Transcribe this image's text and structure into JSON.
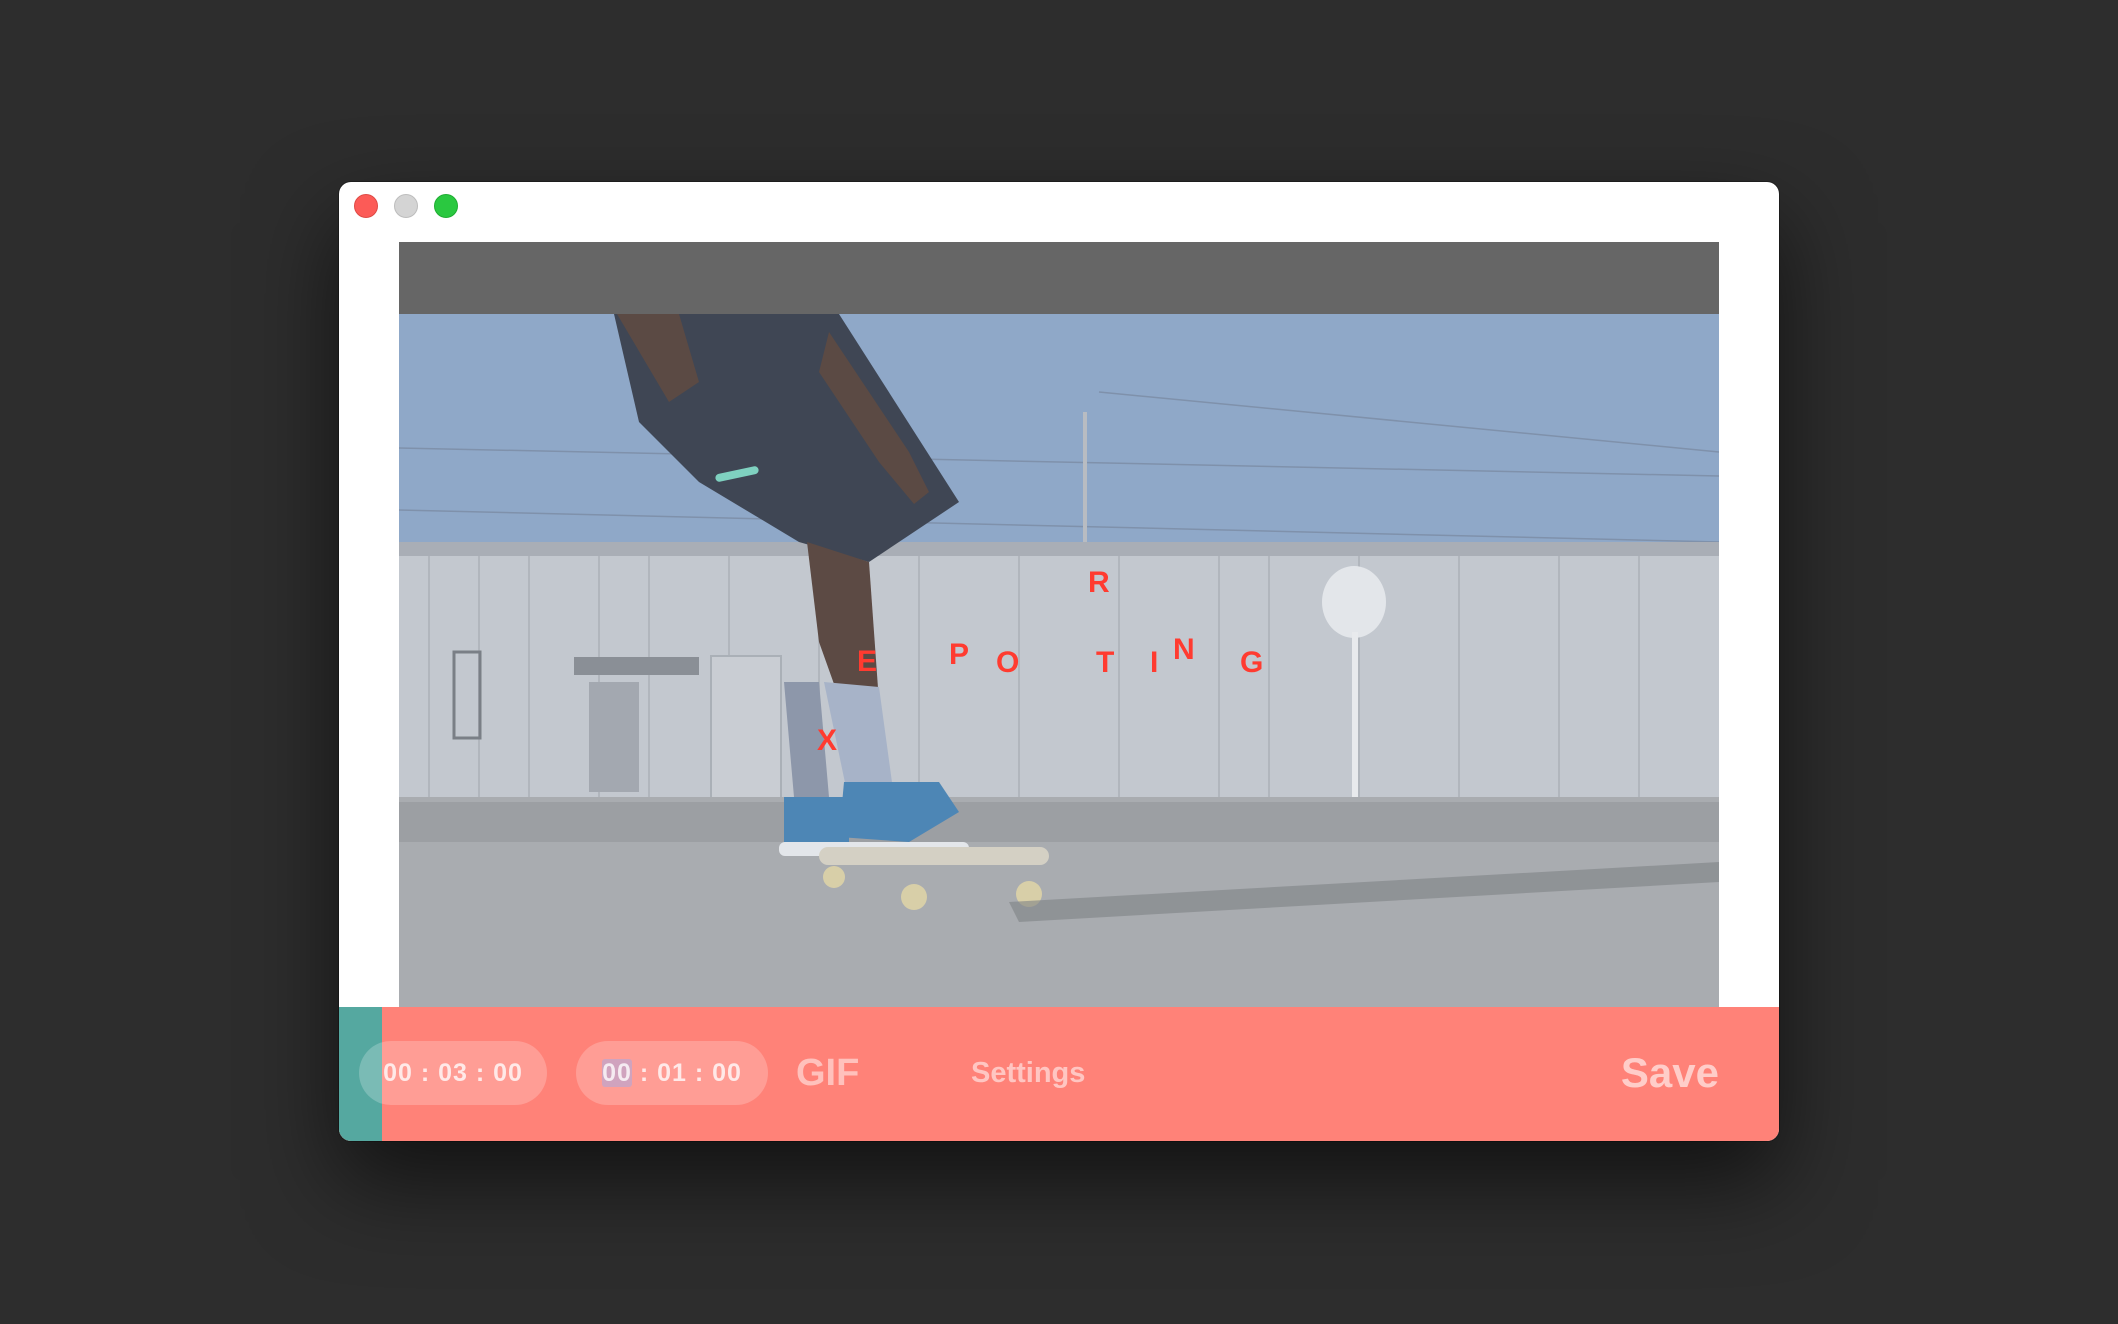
{
  "window": {
    "controls": {
      "close": "close",
      "minimize": "minimize",
      "maximize": "maximize"
    }
  },
  "overlay": {
    "status_letters": [
      "X",
      "E",
      "P",
      "O",
      "R",
      "T",
      "I",
      "N",
      "G"
    ],
    "letter_color": "#ff3b30"
  },
  "controls": {
    "duration": "00 : 03 : 00",
    "position_segment": "00",
    "position_rest": " : 01 : 00",
    "format_label": "GIF",
    "settings_label": "Settings",
    "save_label": "Save",
    "progress_fraction": 0.03
  },
  "colors": {
    "bar": "#ff8278",
    "progress": "#55a8a0"
  }
}
